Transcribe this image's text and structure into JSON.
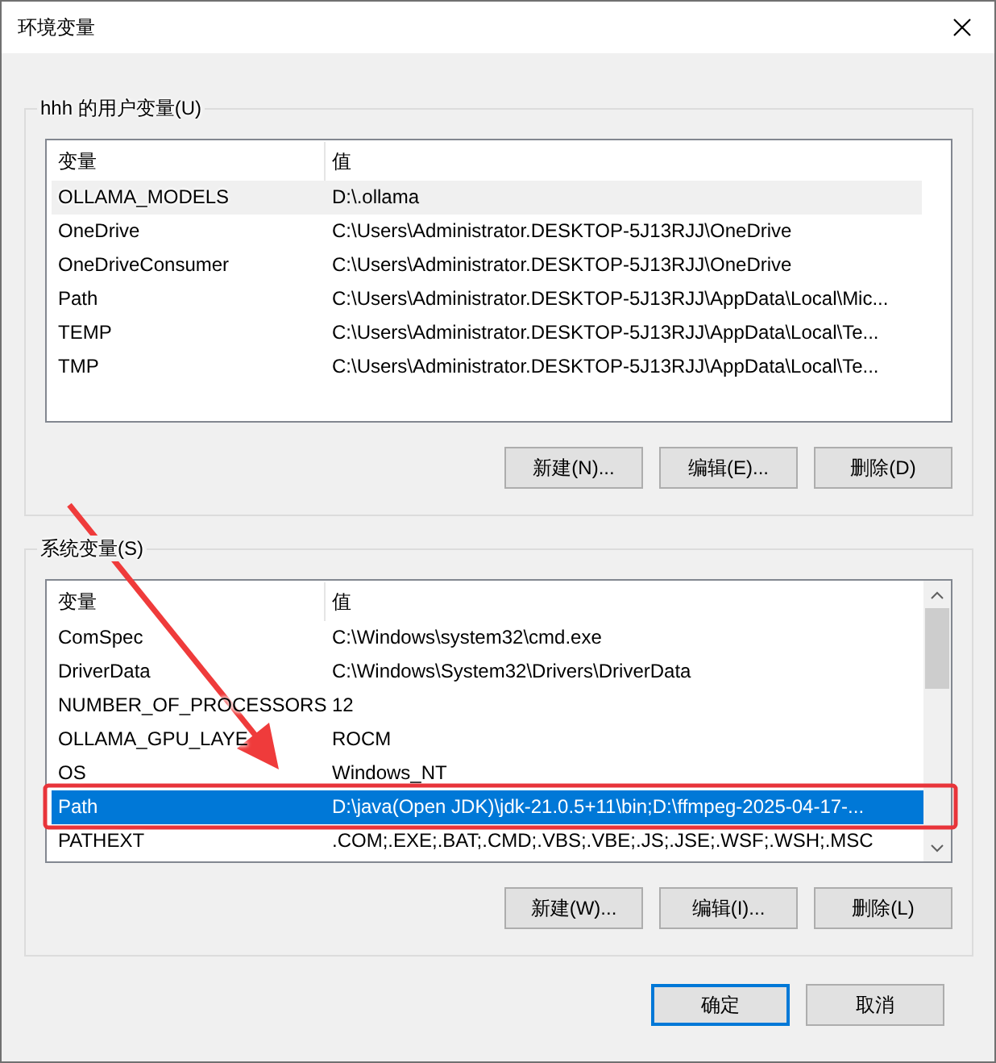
{
  "window": {
    "title": "环境变量"
  },
  "user_variables": {
    "legend": "hhh 的用户变量(U)",
    "columns": [
      "变量",
      "值"
    ],
    "rows": [
      {
        "name": "OLLAMA_MODELS",
        "value": "D:\\.ollama",
        "selected": false,
        "hovered": true
      },
      {
        "name": "OneDrive",
        "value": "C:\\Users\\Administrator.DESKTOP-5J13RJJ\\OneDrive",
        "selected": false,
        "hovered": false
      },
      {
        "name": "OneDriveConsumer",
        "value": "C:\\Users\\Administrator.DESKTOP-5J13RJJ\\OneDrive",
        "selected": false,
        "hovered": false
      },
      {
        "name": "Path",
        "value": "C:\\Users\\Administrator.DESKTOP-5J13RJJ\\AppData\\Local\\Mic...",
        "selected": false,
        "hovered": false
      },
      {
        "name": "TEMP",
        "value": "C:\\Users\\Administrator.DESKTOP-5J13RJJ\\AppData\\Local\\Te...",
        "selected": false,
        "hovered": false
      },
      {
        "name": "TMP",
        "value": "C:\\Users\\Administrator.DESKTOP-5J13RJJ\\AppData\\Local\\Te...",
        "selected": false,
        "hovered": false
      }
    ],
    "buttons": [
      {
        "label": "新建(N)..."
      },
      {
        "label": "编辑(E)..."
      },
      {
        "label": "删除(D)"
      }
    ]
  },
  "system_variables": {
    "legend": "系统变量(S)",
    "columns": [
      "变量",
      "值"
    ],
    "rows": [
      {
        "name": "ComSpec",
        "value": "C:\\Windows\\system32\\cmd.exe",
        "selected": false,
        "hovered": false
      },
      {
        "name": "DriverData",
        "value": "C:\\Windows\\System32\\Drivers\\DriverData",
        "selected": false,
        "hovered": false
      },
      {
        "name": "NUMBER_OF_PROCESSORS",
        "value": "12",
        "selected": false,
        "hovered": false
      },
      {
        "name": "OLLAMA_GPU_LAYE",
        "value": "ROCM",
        "selected": false,
        "hovered": false
      },
      {
        "name": "OS",
        "value": "Windows_NT",
        "selected": false,
        "hovered": false
      },
      {
        "name": "Path",
        "value": "D:\\java(Open JDK)\\jdk-21.0.5+11\\bin;D:\\ffmpeg-2025-04-17-...",
        "selected": true,
        "hovered": false
      },
      {
        "name": "PATHEXT",
        "value": ".COM;.EXE;.BAT;.CMD;.VBS;.VBE;.JS;.JSE;.WSF;.WSH;.MSC",
        "selected": false,
        "hovered": false
      }
    ],
    "buttons": [
      {
        "label": "新建(W)..."
      },
      {
        "label": "编辑(I)..."
      },
      {
        "label": "删除(L)"
      }
    ]
  },
  "footer_buttons": [
    {
      "label": "确定",
      "default": true
    },
    {
      "label": "取消",
      "default": false
    }
  ]
}
